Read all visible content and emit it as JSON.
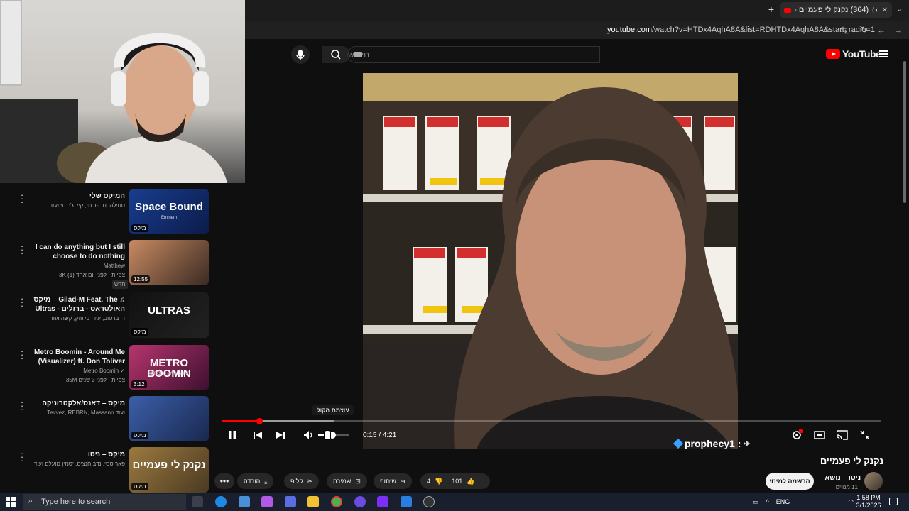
{
  "browser": {
    "tab_title": "(364) נקנק לי פעמיים - YouTube",
    "url_host": "youtube.com",
    "url_path": "/watch?v=HTDx4AqhA8A&list=RDHTDx4AqhA8A&start_radio=1"
  },
  "youtube": {
    "search_placeholder": "חיפוש",
    "logo_text": "YouTube"
  },
  "playlist": [
    {
      "title": "המיקס שלי",
      "sub1": "סטילה, חן פורתי, קיי. ג'י. סי ועוד",
      "sub2": "",
      "sub3": "",
      "badge": "מיקס",
      "duration": "",
      "thumb_text": "Space Bound",
      "thumb_sub": "Eminem",
      "colors": [
        "#1a3d8f",
        "#0b1c4a"
      ]
    },
    {
      "title": "I can do anything but I still choose to do nothing",
      "sub1": "Matthew",
      "sub2": "3K צפיות · לפני יום אחד (1)",
      "sub3": "חדש",
      "badge": "",
      "duration": "12:55",
      "thumb_text": "",
      "thumb_sub": "",
      "colors": [
        "#c98b63",
        "#3a2a22"
      ]
    },
    {
      "title": "מיקס – Gilad-M Feat. The ♫ Ultras - האולטראס - ברזלים",
      "sub1": "דן ברסוב, עידו בי ווזק, קשה ועוד",
      "sub2": "",
      "sub3": "",
      "badge": "מיקס",
      "duration": "",
      "thumb_text": "ULTRAS",
      "thumb_sub": "",
      "colors": [
        "#111111",
        "#222222"
      ]
    },
    {
      "title": "Metro Boomin - Around Me (Visualizer) ft. Don Toliver",
      "sub1": "Metro Boomin ✓",
      "sub2": "35M צפיות · לפני 3 שנים",
      "sub3": "",
      "badge": "",
      "duration": "3:12",
      "thumb_text": "METRO BOOMIN",
      "thumb_sub": "HEROES & VILLAINS",
      "colors": [
        "#b8356e",
        "#3d1030"
      ]
    },
    {
      "title": "מיקס – דאנס/אלקטרוניקה",
      "sub1": "Tevvez, REBRN, Massano ועוד",
      "sub2": "",
      "sub3": "",
      "badge": "מיקס",
      "duration": "",
      "thumb_text": "",
      "thumb_sub": "",
      "colors": [
        "#3b5fa8",
        "#1a2850"
      ]
    },
    {
      "title": "מיקס – ניטו",
      "sub1": "פאר טסי, נדב חנציס, יסמין מועלם ועוד",
      "sub2": "",
      "sub3": "",
      "badge": "מיקס",
      "duration": "",
      "thumb_text": "נקנק לי פעמיים",
      "thumb_sub": "",
      "colors": [
        "#9c7a40",
        "#4a3a22"
      ]
    }
  ],
  "player": {
    "time_current": "0:15",
    "time_total": "4:21",
    "progress": 0.057,
    "buffered": 0.17,
    "volume": 0.45,
    "tooltip": "עוצמת הקול",
    "channel_overlay": "prophecy1 :",
    "hd_badge": "HD"
  },
  "video": {
    "title": "נקנק לי פעמיים",
    "channel_name": "ניטו – נושא",
    "subscribers": "11 מנויים",
    "subscribe_label": "הרשמה למינוי",
    "likes": "101",
    "dislikes": "4",
    "share_label": "שיתוף",
    "save_label": "שמירה",
    "clip_label": "קליפ",
    "download_label": "הורדה"
  },
  "taskbar": {
    "search_placeholder": "Type here to search",
    "language": "ENG",
    "time": "1:58 PM",
    "date": "3/1/2026"
  },
  "colors": {
    "accent": "#ff0000",
    "bg": "#0f0f0f"
  }
}
